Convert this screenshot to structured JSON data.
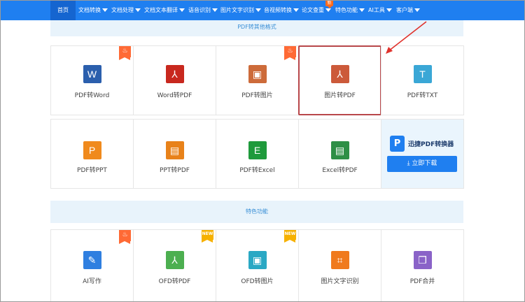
{
  "nav": {
    "items": [
      {
        "label": "首页",
        "caret": false
      },
      {
        "label": "文档转换",
        "caret": true
      },
      {
        "label": "文档处理",
        "caret": true
      },
      {
        "label": "文档文本翻译",
        "caret": true
      },
      {
        "label": "语音识别",
        "caret": true
      },
      {
        "label": "图片文字识别",
        "caret": true
      },
      {
        "label": "音视频转换",
        "caret": true
      },
      {
        "label": "论文查重",
        "caret": true
      },
      {
        "label": "特色功能",
        "caret": true
      },
      {
        "label": "AI工具",
        "caret": true
      },
      {
        "label": "客户端",
        "caret": true
      }
    ],
    "new_badge": "新"
  },
  "section1": {
    "title": "PDF转其他格式"
  },
  "section2": {
    "title": "特色功能"
  },
  "row1": [
    {
      "label": "PDF转Word",
      "icon": "word-icon",
      "glyph": "W",
      "color": "#2b5fad",
      "badge": "fire"
    },
    {
      "label": "Word转PDF",
      "icon": "pdf-icon",
      "glyph": "⅄",
      "color": "#c8281e",
      "badge": ""
    },
    {
      "label": "PDF转图片",
      "icon": "image-icon",
      "glyph": "▣",
      "color": "#cd6b3a",
      "badge": "fire"
    },
    {
      "label": "图片转PDF",
      "icon": "pdf-icon",
      "glyph": "⅄",
      "color": "#cc5a3a",
      "badge": ""
    },
    {
      "label": "PDF转TXT",
      "icon": "txt-icon",
      "glyph": "T",
      "color": "#3aa7d6",
      "badge": ""
    }
  ],
  "row2": [
    {
      "label": "PDF转PPT",
      "icon": "ppt-icon",
      "glyph": "P",
      "color": "#f08a1d"
    },
    {
      "label": "PPT转PDF",
      "icon": "ppt-pdf-icon",
      "glyph": "▤",
      "color": "#e8821a"
    },
    {
      "label": "PDF转Excel",
      "icon": "excel-icon",
      "glyph": "E",
      "color": "#1f9a3c"
    },
    {
      "label": "Excel转PDF",
      "icon": "excel-pdf-icon",
      "glyph": "▤",
      "color": "#2e8f46"
    }
  ],
  "promo": {
    "brand": "迅捷PDF转换器",
    "download_label": "立即下载"
  },
  "row3": [
    {
      "label": "AI写作",
      "icon": "pen-icon",
      "glyph": "✎",
      "color": "#2f7fe0",
      "badge": "fire"
    },
    {
      "label": "OFD转PDF",
      "icon": "ofd-pdf-icon",
      "glyph": "⅄",
      "color": "#4caf50",
      "badge": "NEW"
    },
    {
      "label": "OFD转图片",
      "icon": "ofd-image-icon",
      "glyph": "▣",
      "color": "#2aa8c4",
      "badge": "NEW"
    },
    {
      "label": "图片文字识别",
      "icon": "scan-icon",
      "glyph": "⌗",
      "color": "#f07a1d",
      "badge": ""
    },
    {
      "label": "PDF合并",
      "icon": "merge-icon",
      "glyph": "❐",
      "color": "#8a63c8",
      "badge": ""
    }
  ]
}
